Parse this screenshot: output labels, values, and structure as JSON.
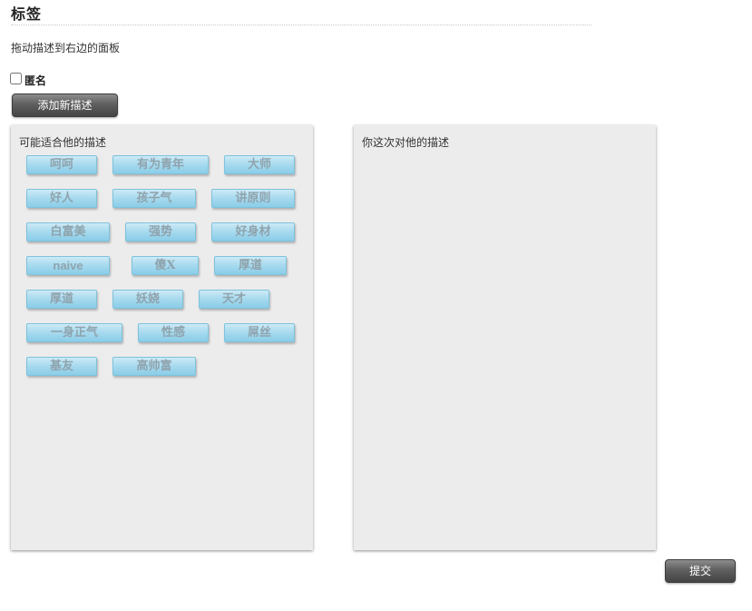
{
  "page": {
    "title": "标签",
    "instruction": "拖动描述到右边的面板",
    "anonymous_label": "匿名",
    "anonymous_checked": false,
    "add_button_label": "添加新描述",
    "submit_button_label": "提交"
  },
  "left_panel": {
    "title": "可能适合他的描述",
    "tag_rows": [
      [
        "呵呵",
        "有为青年",
        "大师"
      ],
      [
        "好人",
        "孩子气",
        "讲原则"
      ],
      [
        "白富美",
        "强势",
        "好身材"
      ],
      [
        "naive",
        "傻X",
        "厚道"
      ],
      [
        "厚道",
        "妖娆",
        "天才"
      ],
      [
        "一身正气",
        "性感",
        "屌丝"
      ],
      [
        "基友",
        "高帅富"
      ]
    ]
  },
  "right_panel": {
    "title": "你这次对他的描述"
  },
  "colors": {
    "tag_gradient_top": "#cdeaf6",
    "tag_gradient_bottom": "#8acde8",
    "tag_text": "#8fa3ad",
    "panel_bg": "#ececec",
    "button_dark": "#555555"
  }
}
